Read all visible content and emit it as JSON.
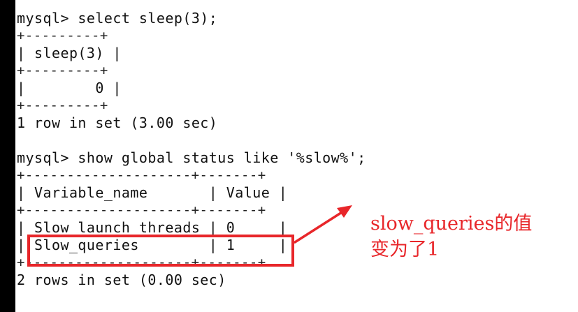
{
  "terminal": {
    "lines": [
      "mysql> select sleep(3);",
      "+---------+",
      "| sleep(3) |",
      "+---------+",
      "|        0 |",
      "+---------+",
      "1 row in set (3.00 sec)",
      "",
      "mysql> show global status like '%slow%';",
      "+--------------------+-------+",
      "| Variable_name       | Value |",
      "+--------------------+-------+",
      "| Slow_launch_threads | 0     |",
      "| Slow_queries        | 1     |",
      "+--------------------+-------+",
      "2 rows in set (0.00 sec)",
      ""
    ]
  },
  "annotation": {
    "line1": "slow_queries的值",
    "line2": "变为了1",
    "color": "#e8262a"
  }
}
